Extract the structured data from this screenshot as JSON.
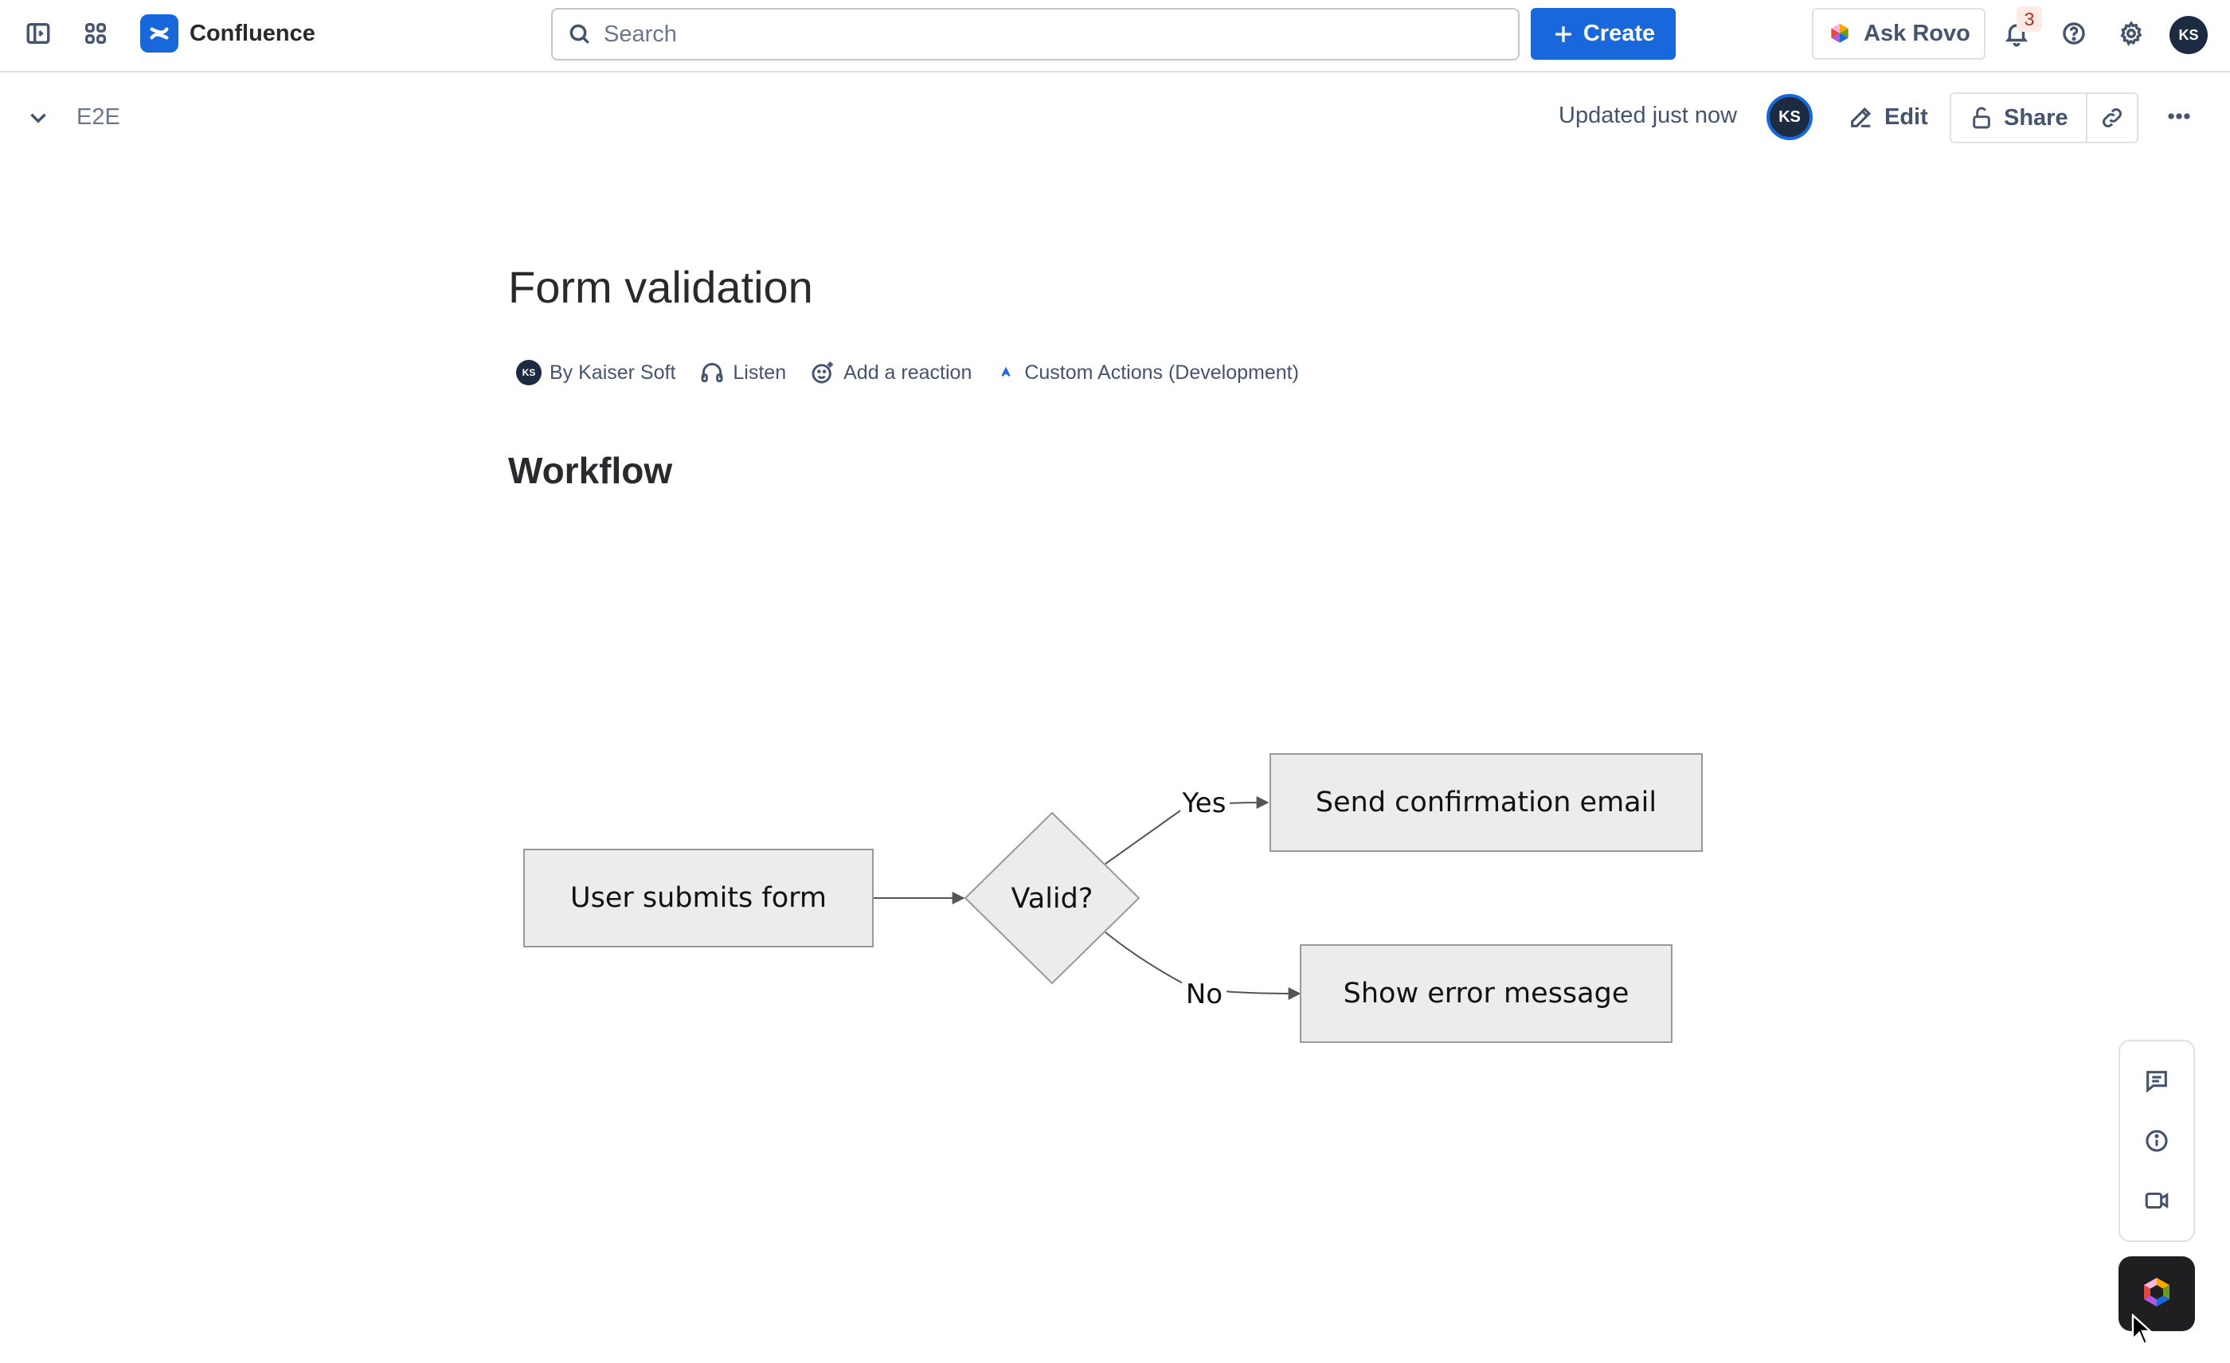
{
  "app": {
    "name": "Confluence",
    "search_placeholder": "Search",
    "create_label": "Create",
    "ask_rovo_label": "Ask Rovo",
    "notification_count": "3",
    "user_initials": "KS"
  },
  "page_header": {
    "breadcrumb": "E2E",
    "updated": "Updated just now",
    "editor_initials": "KS",
    "edit_label": "Edit",
    "share_label": "Share"
  },
  "page": {
    "title": "Form validation",
    "byline": {
      "author": "By Kaiser Soft",
      "author_initials": "KS",
      "listen": "Listen",
      "reaction": "Add a reaction",
      "app": "Custom Actions (Development)"
    },
    "heading": "Workflow"
  },
  "diagram": {
    "nodes": {
      "start": "User submits form",
      "decision": "Valid?",
      "yes_target": "Send confirmation email",
      "no_target": "Show error message"
    },
    "edges": {
      "yes": "Yes",
      "no": "No"
    },
    "colors": {
      "node_fill": "#ececec",
      "node_stroke": "#999999",
      "edge": "#555555"
    }
  },
  "colors": {
    "brand": "#1868db",
    "avatar": "#1c2b41"
  }
}
